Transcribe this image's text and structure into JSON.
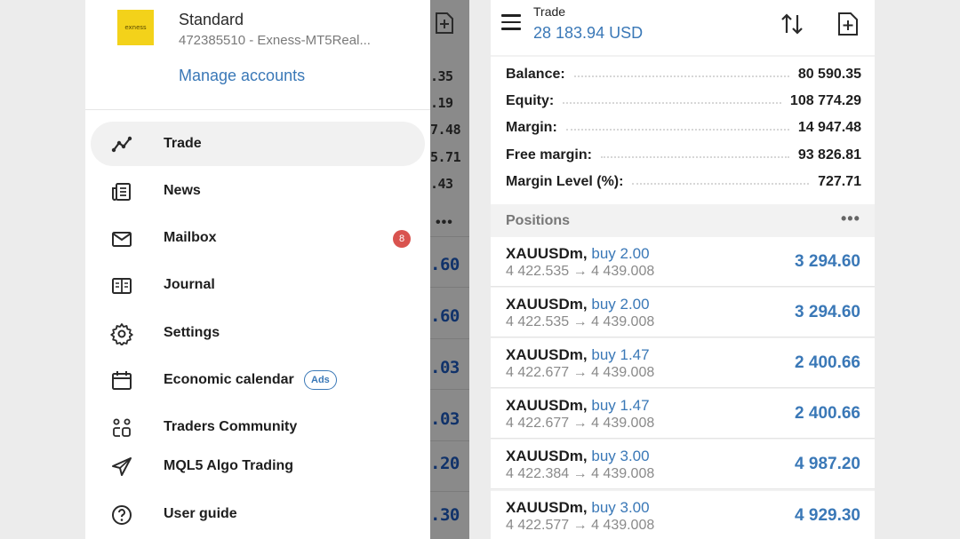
{
  "drawer": {
    "account": {
      "logo_text": "exness",
      "name": "Standard",
      "number_server": "472385510 - Exness-MT5Real...",
      "manage_label": "Manage accounts"
    },
    "items": [
      {
        "label": "Trade",
        "icon": "trade-chart-icon",
        "active": true
      },
      {
        "label": "News",
        "icon": "news-icon"
      },
      {
        "label": "Mailbox",
        "icon": "mail-icon",
        "badge": "8"
      },
      {
        "label": "Journal",
        "icon": "journal-icon"
      },
      {
        "label": "Settings",
        "icon": "gear-icon"
      },
      {
        "label": "Economic calendar",
        "icon": "calendar-icon",
        "tag": "Ads"
      },
      {
        "label": "Traders Community",
        "icon": "community-icon"
      },
      {
        "label": "MQL5 Algo Trading",
        "icon": "send-icon"
      },
      {
        "label": "User guide",
        "icon": "help-icon"
      }
    ]
  },
  "background_strip": {
    "summary_fragments": [
      ".35",
      ".19",
      "7.48",
      "5.71",
      ".43"
    ],
    "profit_fragments": [
      ".60",
      ".60",
      ".03",
      ".03",
      ".20",
      ".30"
    ]
  },
  "trade": {
    "title": "Trade",
    "balance_header": "28 183.94 USD",
    "summary": [
      {
        "label": "Balance:",
        "value": "80 590.35"
      },
      {
        "label": "Equity:",
        "value": "108 774.29"
      },
      {
        "label": "Margin:",
        "value": "14 947.48"
      },
      {
        "label": "Free margin:",
        "value": "93 826.81"
      },
      {
        "label": "Margin Level (%):",
        "value": "727.71"
      }
    ],
    "positions_label": "Positions",
    "positions": [
      {
        "symbol": "XAUUSDm,",
        "side": "buy 2.00",
        "prices": "4 422.535 → 4 439.008",
        "profit": "3 294.60"
      },
      {
        "symbol": "XAUUSDm,",
        "side": "buy 2.00",
        "prices": "4 422.535 → 4 439.008",
        "profit": "3 294.60"
      },
      {
        "symbol": "XAUUSDm,",
        "side": "buy 1.47",
        "prices": "4 422.677 → 4 439.008",
        "profit": "2 400.66"
      },
      {
        "symbol": "XAUUSDm,",
        "side": "buy 1.47",
        "prices": "4 422.677 → 4 439.008",
        "profit": "2 400.66"
      },
      {
        "symbol": "XAUUSDm,",
        "side": "buy 3.00",
        "prices": "4 422.384 → 4 439.008",
        "profit": "4 987.20"
      },
      {
        "symbol": "XAUUSDm,",
        "side": "buy 3.00",
        "prices": "4 422.577 → 4 439.008",
        "profit": "4 929.30"
      }
    ]
  },
  "colors": {
    "accent": "#3a78b7",
    "badge": "#d9534f",
    "logo": "#f3d21a",
    "dim_overlay": "#8a8a8a"
  }
}
